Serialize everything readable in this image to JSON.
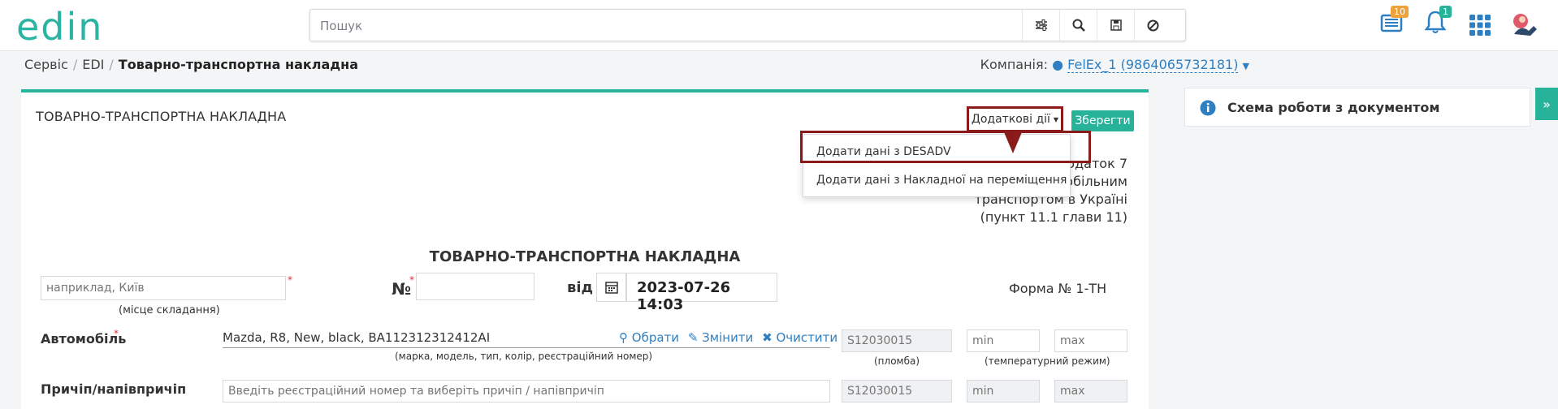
{
  "brand": {
    "logo_text": "edin",
    "accent": "#29b39d",
    "highlight": "#8b1a1a"
  },
  "search": {
    "placeholder": "Пошук",
    "icons": [
      "sliders-icon",
      "search-icon",
      "save-icon",
      "ban-icon"
    ]
  },
  "topbar": {
    "news_badge": "10",
    "notif_badge": "1"
  },
  "breadcrumb": {
    "items": [
      "Сервіс",
      "EDI"
    ],
    "current": "Товарно-транспортна накладна"
  },
  "company": {
    "label": "Компанія:",
    "value": "FelEx_1 (9864065732181)"
  },
  "panel": {
    "title": "ТОВАРНО-ТРАНСПОРТНА НАКЛАДНА",
    "more_actions": "Додаткові дії",
    "save": "Зберегти",
    "menu": [
      "Додати дані з DESADV",
      "Додати дані з Накладної на переміщення"
    ],
    "legal": [
      "Додаток 7",
      "мобільним",
      "транспортом в Україні",
      "(пункт 11.1 глави 11)"
    ],
    "doc_title": "ТОВАРНО-ТРАНСПОРТНА НАКЛАДНА",
    "place_placeholder": "наприклад, Київ",
    "place_caption": "(місце складання)",
    "number_label": "№",
    "from_label": "від",
    "date": "2023-07-26 14:03",
    "form_label": "Форма № 1-ТН",
    "car": {
      "label": "Автомобіль",
      "value": "Mazda, R8, New, black, BA112312312412AI",
      "caption": "(марка, модель, тип, колір, реєстраційний номер)",
      "choose": "Обрати",
      "change": "Змінити",
      "clear": "Очистити",
      "seal_placeholder": "S12030015",
      "seal_caption": "(пломба)",
      "min_placeholder": "min",
      "max_placeholder": "max",
      "temp_caption": "(температурний режим)"
    },
    "trailer": {
      "label": "Причіп/напівпричіп",
      "placeholder": "Введіть реєстраційний номер та виберіть причіп / напівпричіп",
      "seal_placeholder": "S12030015",
      "min_placeholder": "min",
      "max_placeholder": "max"
    }
  },
  "right_panel": {
    "title": "Схема роботи з документом"
  }
}
